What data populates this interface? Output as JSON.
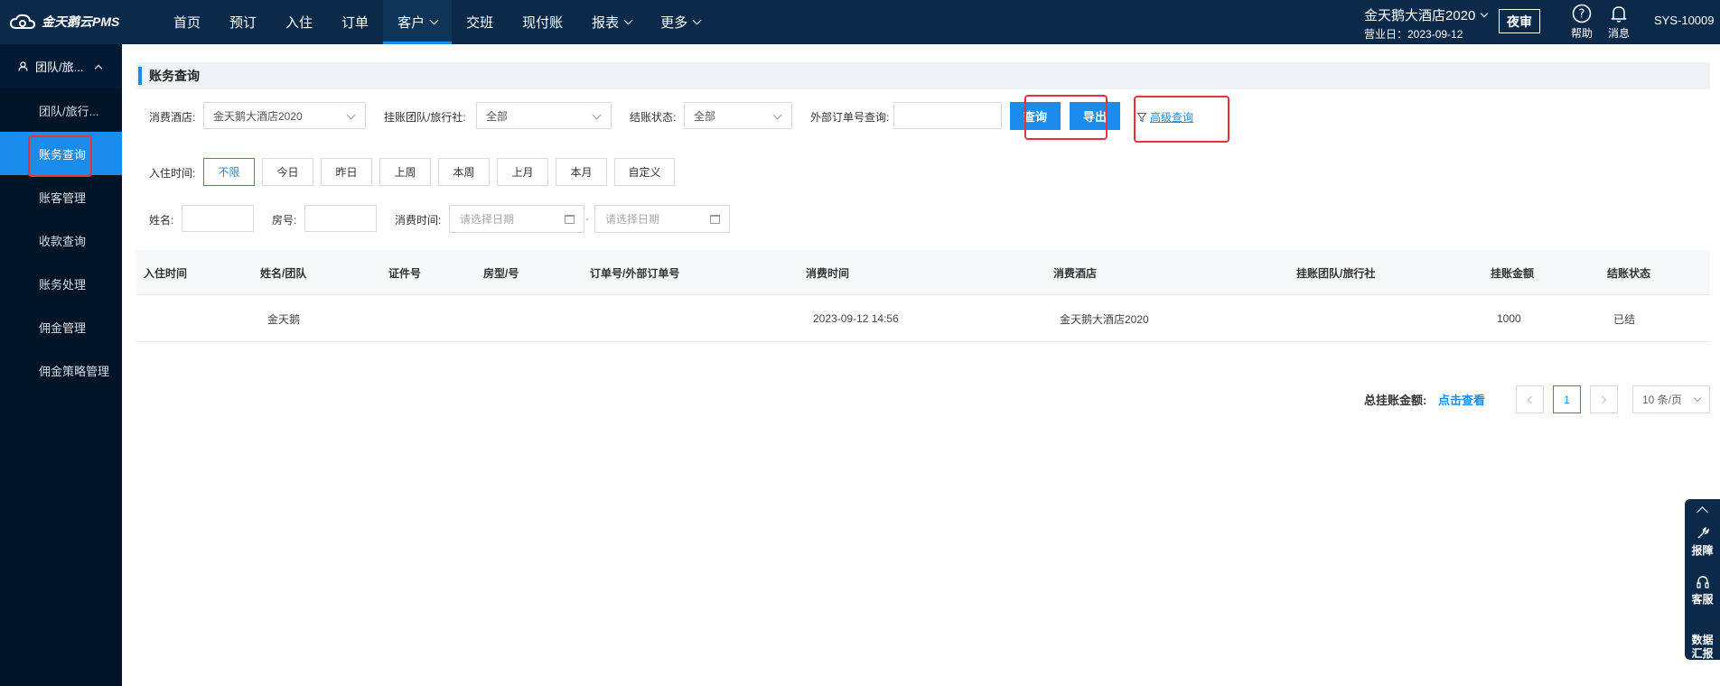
{
  "app": {
    "logo_text": "金天鹅云PMS"
  },
  "nav": {
    "items": [
      {
        "label": "首页",
        "active": false,
        "dropdown": false
      },
      {
        "label": "预订",
        "active": false,
        "dropdown": false
      },
      {
        "label": "入住",
        "active": false,
        "dropdown": false
      },
      {
        "label": "订单",
        "active": false,
        "dropdown": false
      },
      {
        "label": "客户",
        "active": true,
        "dropdown": true
      },
      {
        "label": "交班",
        "active": false,
        "dropdown": false
      },
      {
        "label": "现付账",
        "active": false,
        "dropdown": false
      },
      {
        "label": "报表",
        "active": false,
        "dropdown": true
      },
      {
        "label": "更多",
        "active": false,
        "dropdown": true
      }
    ]
  },
  "header": {
    "hotel_name": "金天鹅大酒店2020",
    "business_date": "营业日：2023-09-12",
    "night_audit": "夜审",
    "help_label": "帮助",
    "messages_label": "消息",
    "user": "SYS-10009"
  },
  "sidebar": {
    "group_label": "团队/旅...",
    "items": [
      {
        "label": "团队/旅行...",
        "active": false
      },
      {
        "label": "账务查询",
        "active": true
      },
      {
        "label": "账客管理",
        "active": false
      },
      {
        "label": "收款查询",
        "active": false
      },
      {
        "label": "账务处理",
        "active": false
      },
      {
        "label": "佣金管理",
        "active": false
      },
      {
        "label": "佣金策略管理",
        "active": false
      }
    ]
  },
  "page": {
    "title": "账务查询"
  },
  "filters": {
    "hotel_label": "消费酒店:",
    "hotel_value": "金天鹅大酒店2020",
    "team_label": "挂账团队/旅行社:",
    "team_value": "全部",
    "status_label": "结账状态:",
    "status_value": "全部",
    "ext_order_label": "外部订单号查询:",
    "ext_order_value": "",
    "query_button": "查询",
    "export_button": "导出",
    "advanced_query": "高级查询",
    "checkin_label": "入住时间:",
    "time_chips": [
      "不限",
      "今日",
      "昨日",
      "上周",
      "本周",
      "上月",
      "本月",
      "自定义"
    ],
    "selected_chip": "不限",
    "name_label": "姓名:",
    "room_label": "房号:",
    "consume_time_label": "消费时间:",
    "date_placeholder": "请选择日期",
    "date_sep": "-"
  },
  "table": {
    "columns": [
      "入住时间",
      "姓名/团队",
      "证件号",
      "房型/号",
      "订单号/外部订单号",
      "消费时间",
      "消费酒店",
      "挂账团队/旅行社",
      "挂账金额",
      "结账状态"
    ],
    "rows": [
      {
        "checkin": "",
        "name": "金天鹅",
        "id_no": "",
        "room": "",
        "order_no": "",
        "consume_time": "2023-09-12 14:56",
        "hotel": "金天鹅大酒店2020",
        "team": "",
        "amount": "1000",
        "status": "已结"
      }
    ]
  },
  "footer": {
    "total_label": "总挂账金额:",
    "total_link": "点击查看",
    "current_page": "1",
    "page_size": "10 条/页"
  },
  "float_bar": {
    "items": [
      {
        "label": "报障",
        "icon": "wrench-icon"
      },
      {
        "label": "客服",
        "icon": "headset-icon"
      },
      {
        "label": "数据\n汇报",
        "icon": "report-icon"
      }
    ]
  },
  "colors": {
    "topbar": "#0b2a4a",
    "sidebar": "#001427",
    "accent": "#1b8ceb",
    "highlight": "#e8333a"
  }
}
